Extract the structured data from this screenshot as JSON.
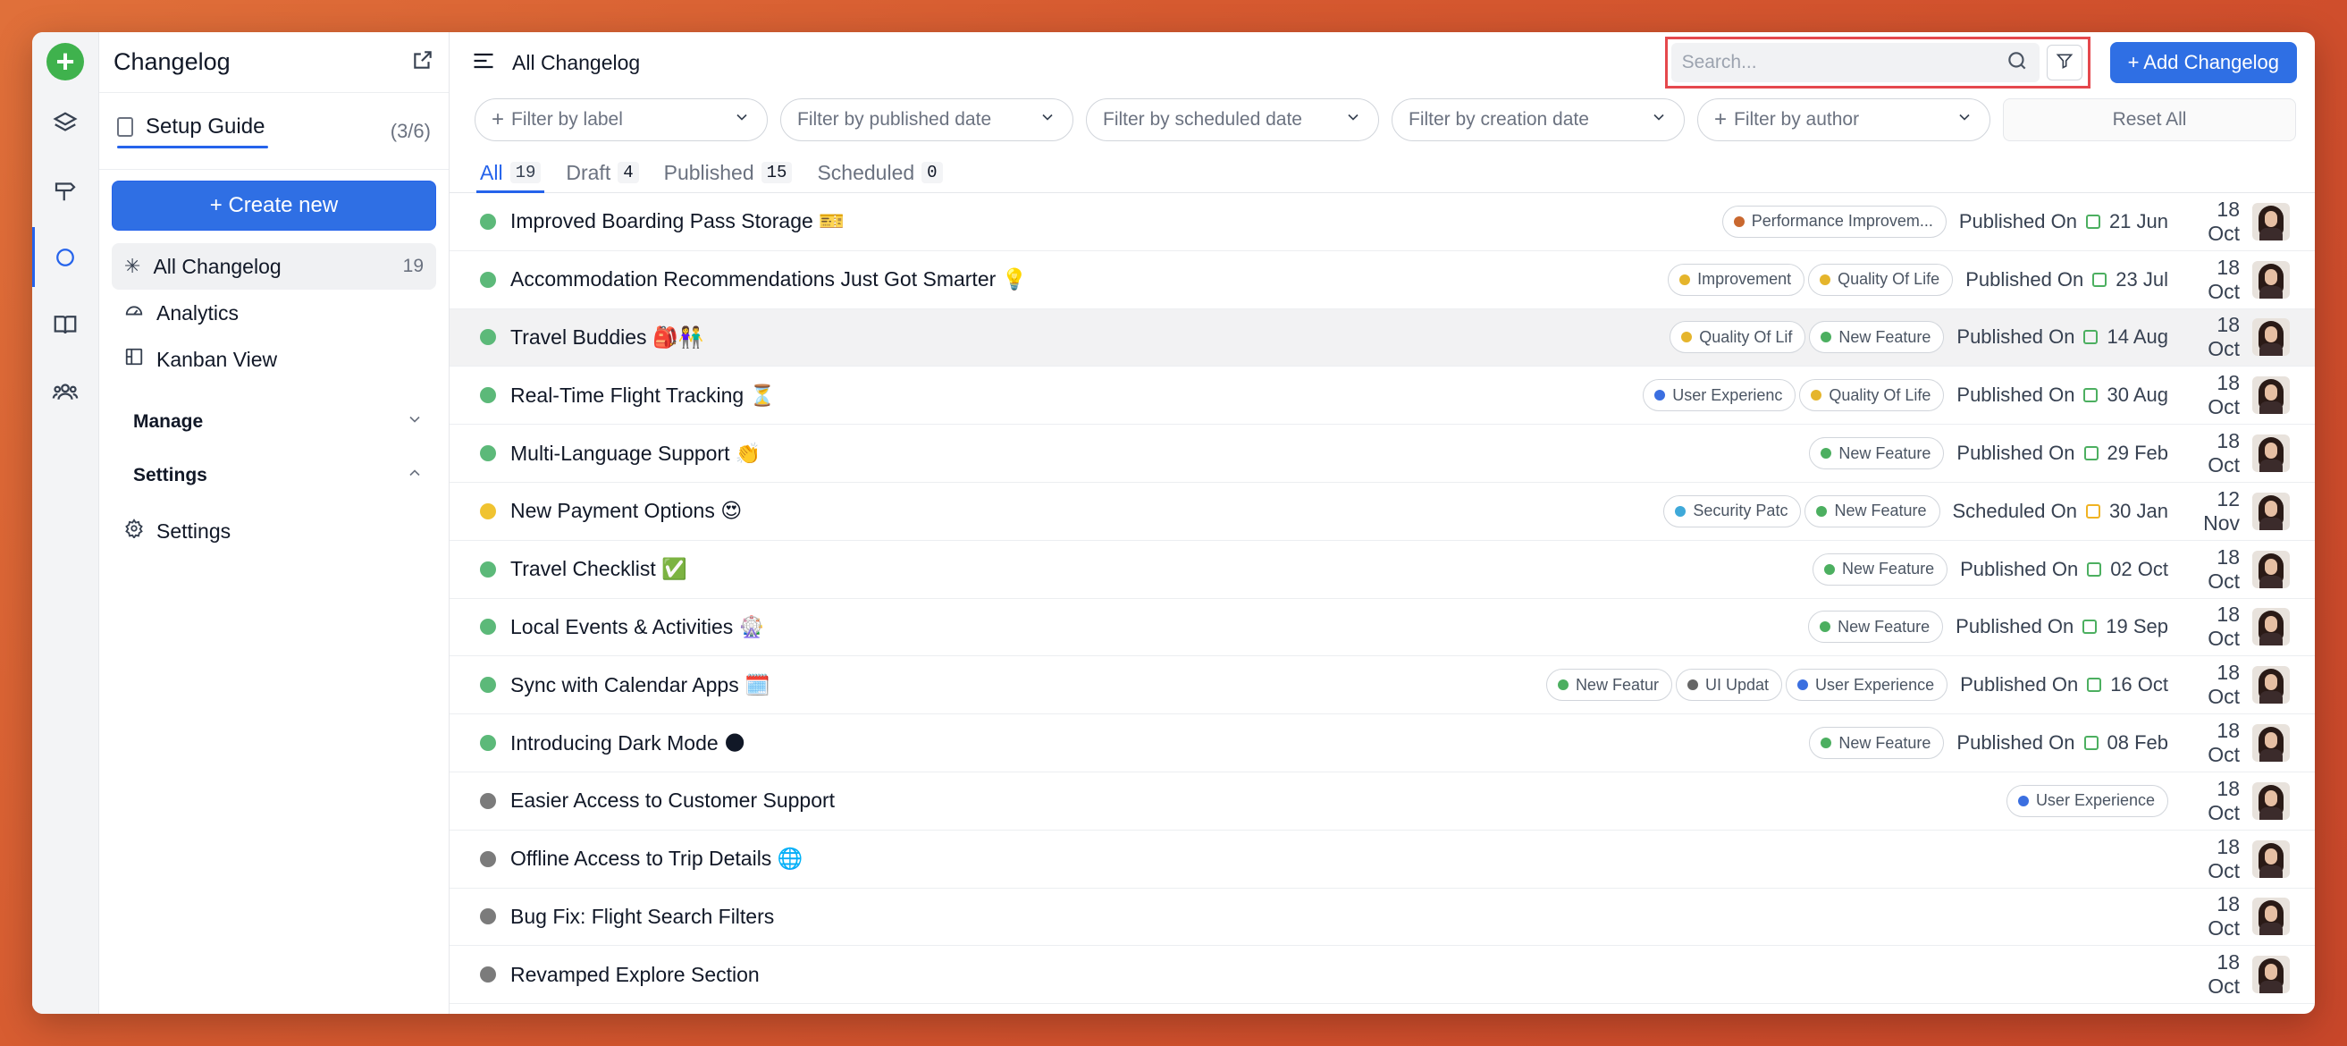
{
  "sidebar": {
    "title": "Changelog",
    "setup_label": "Setup Guide",
    "setup_count": "(3/6)",
    "create_label": "+ Create new",
    "nav": [
      {
        "label": "All Changelog",
        "count": "19"
      },
      {
        "label": "Analytics"
      },
      {
        "label": "Kanban View"
      }
    ],
    "manage_label": "Manage",
    "settings_label": "Settings",
    "settings_item": "Settings"
  },
  "header": {
    "title": "All Changelog",
    "search_placeholder": "Search...",
    "add_label": "+ Add Changelog"
  },
  "filters": [
    {
      "label": "Filter by label",
      "plus": true
    },
    {
      "label": "Filter by published date",
      "plus": false
    },
    {
      "label": "Filter by scheduled date",
      "plus": false
    },
    {
      "label": "Filter by creation date",
      "plus": false
    },
    {
      "label": "Filter by author",
      "plus": true
    }
  ],
  "reset_label": "Reset All",
  "tabs": [
    {
      "label": "All",
      "count": "19"
    },
    {
      "label": "Draft",
      "count": "4"
    },
    {
      "label": "Published",
      "count": "15"
    },
    {
      "label": "Scheduled",
      "count": "0"
    }
  ],
  "colors": {
    "published": "#5cb979",
    "scheduled": "#f0c330",
    "draft": "#7b7b7b",
    "accent": "#2f6fe4"
  },
  "rows": [
    {
      "title": "Improved Boarding Pass Storage 🎫",
      "status": "published",
      "labels": [
        {
          "text": "Performance Improvem...",
          "color": "#c9682f"
        }
      ],
      "state": "Published On",
      "date": "21 Jun",
      "created": "18 Oct"
    },
    {
      "title": "Accommodation Recommendations Just Got Smarter 💡",
      "status": "published",
      "labels": [
        {
          "text": "Improvement",
          "color": "#e5b52c"
        },
        {
          "text": "Quality Of Life",
          "color": "#e5b52c"
        }
      ],
      "state": "Published On",
      "date": "23 Jul",
      "created": "18 Oct"
    },
    {
      "title": "Travel Buddies 🎒👫",
      "status": "published",
      "labels": [
        {
          "text": "Quality Of Lif",
          "color": "#e5b52c"
        },
        {
          "text": "New Feature",
          "color": "#4caf60"
        }
      ],
      "state": "Published On",
      "date": "14 Aug",
      "created": "18 Oct"
    },
    {
      "title": "Real-Time Flight Tracking ⏳",
      "status": "published",
      "labels": [
        {
          "text": "User Experienc",
          "color": "#3b6fe0"
        },
        {
          "text": "Quality Of Life",
          "color": "#e5b52c"
        }
      ],
      "state": "Published On",
      "date": "30 Aug",
      "created": "18 Oct"
    },
    {
      "title": "Multi-Language Support 👏",
      "status": "published",
      "labels": [
        {
          "text": "New Feature",
          "color": "#4caf60"
        }
      ],
      "state": "Published On",
      "date": "29 Feb",
      "created": "18 Oct"
    },
    {
      "title": "New Payment Options 😍",
      "status": "scheduled",
      "labels": [
        {
          "text": "Security Patc",
          "color": "#3fa9d9"
        },
        {
          "text": "New Feature",
          "color": "#4caf60"
        }
      ],
      "state": "Scheduled On",
      "date": "30 Jan",
      "created": "12 Nov"
    },
    {
      "title": "Travel Checklist ✅",
      "status": "published",
      "labels": [
        {
          "text": "New Feature",
          "color": "#4caf60"
        }
      ],
      "state": "Published On",
      "date": "02 Oct",
      "created": "18 Oct"
    },
    {
      "title": "Local Events & Activities 🎡",
      "status": "published",
      "labels": [
        {
          "text": "New Feature",
          "color": "#4caf60"
        }
      ],
      "state": "Published On",
      "date": "19 Sep",
      "created": "18 Oct"
    },
    {
      "title": "Sync with Calendar Apps 🗓️",
      "status": "published",
      "labels": [
        {
          "text": "New Featur",
          "color": "#4caf60"
        },
        {
          "text": "UI Updat",
          "color": "#666666"
        },
        {
          "text": "User Experience",
          "color": "#3b6fe0"
        }
      ],
      "state": "Published On",
      "date": "16 Oct",
      "created": "18 Oct"
    },
    {
      "title": "Introducing Dark Mode 🌑",
      "status": "published",
      "labels": [
        {
          "text": "New Feature",
          "color": "#4caf60"
        }
      ],
      "state": "Published On",
      "date": "08 Feb",
      "created": "18 Oct"
    },
    {
      "title": "Easier Access to Customer Support",
      "status": "draft",
      "labels": [
        {
          "text": "User Experience",
          "color": "#3b6fe0"
        }
      ],
      "state": "",
      "date": "",
      "created": "18 Oct"
    },
    {
      "title": "Offline Access to Trip Details 🌐",
      "status": "draft",
      "labels": [],
      "state": "",
      "date": "",
      "created": "18 Oct"
    },
    {
      "title": "Bug Fix: Flight Search Filters",
      "status": "draft",
      "labels": [],
      "state": "",
      "date": "",
      "created": "18 Oct"
    },
    {
      "title": "Revamped Explore Section",
      "status": "draft",
      "labels": [],
      "state": "",
      "date": "",
      "created": "18 Oct"
    }
  ]
}
